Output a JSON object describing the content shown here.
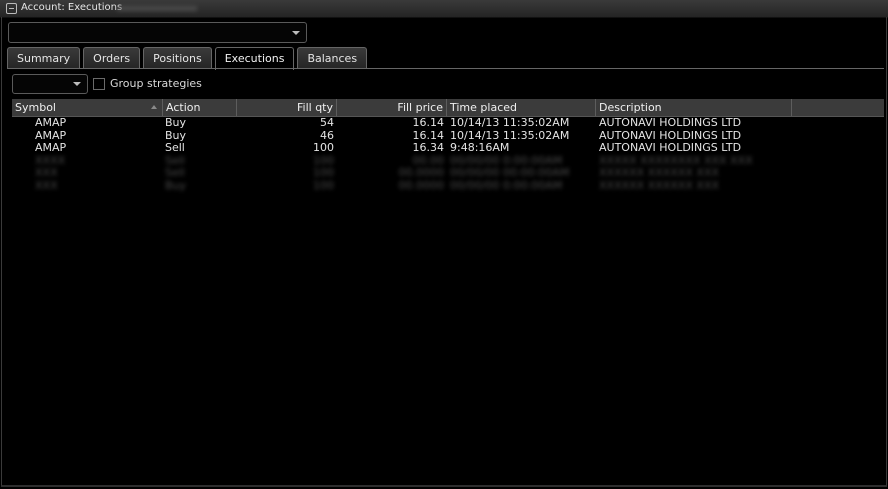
{
  "window": {
    "title": "Account: Executions"
  },
  "account_select": {
    "value": ""
  },
  "tabs": [
    {
      "label": "Summary",
      "active": false
    },
    {
      "label": "Orders",
      "active": false
    },
    {
      "label": "Positions",
      "active": false
    },
    {
      "label": "Executions",
      "active": true
    },
    {
      "label": "Balances",
      "active": false
    }
  ],
  "filter": {
    "select_value": "",
    "group_strategies_label": "Group strategies",
    "group_strategies_checked": false
  },
  "grid": {
    "columns": [
      "Symbol",
      "Action",
      "Fill qty",
      "Fill price",
      "Time placed",
      "Description"
    ],
    "rows": [
      {
        "symbol": "AMAP",
        "action": "Buy",
        "fill_qty": "54",
        "fill_price": "16.14",
        "time_placed": "10/14/13 11:35:02AM",
        "description": "AUTONAVI HOLDINGS LTD",
        "redacted": false
      },
      {
        "symbol": "AMAP",
        "action": "Buy",
        "fill_qty": "46",
        "fill_price": "16.14",
        "time_placed": "10/14/13 11:35:02AM",
        "description": "AUTONAVI HOLDINGS LTD",
        "redacted": false
      },
      {
        "symbol": "AMAP",
        "action": "Sell",
        "fill_qty": "100",
        "fill_price": "16.34",
        "time_placed": "9:48:16AM",
        "description": "AUTONAVI HOLDINGS LTD",
        "redacted": false
      },
      {
        "symbol": "XXXX",
        "action": "Sell",
        "fill_qty": "100",
        "fill_price": "00.00",
        "time_placed": "00/00/00 0:00:00AM",
        "description": "XXXXX XXXXXXXX XXX XXX",
        "redacted": true
      },
      {
        "symbol": "XXX",
        "action": "Sell",
        "fill_qty": "100",
        "fill_price": "00.0000",
        "time_placed": "00/00/00 00:00:00AM",
        "description": "XXXXXX XXXXXX XXX",
        "redacted": true
      },
      {
        "symbol": "XXX",
        "action": "Buy",
        "fill_qty": "100",
        "fill_price": "00.0000",
        "time_placed": "00/00/00 0:00:00AM",
        "description": "XXXXXX XXXXXX XXX",
        "redacted": true
      }
    ]
  },
  "icons": {
    "window_menu": "window-menu-icon",
    "dropdown": "chevron-down-icon",
    "sort": "sort-ascending-icon"
  },
  "colors": {
    "background": "#000000",
    "header": "#3b3b3b",
    "text": "#e4e4e4"
  }
}
